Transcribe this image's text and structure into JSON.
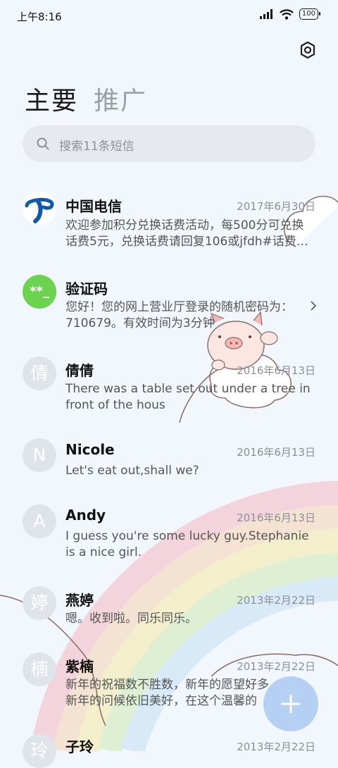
{
  "status": {
    "time": "上午8:16",
    "battery": "100"
  },
  "tabs": {
    "primary": "主要",
    "promo": "推广"
  },
  "search": {
    "placeholder": "搜索11条短信"
  },
  "avatars": {
    "verify": "**_",
    "qianqian": "倩",
    "nicole": "N",
    "andy": "A",
    "yanting": "婷",
    "zinan": "楠",
    "ziling": "玲"
  },
  "messages": [
    {
      "name": "中国电信",
      "date": "2017年6月30日",
      "line1": "欢迎参加积分兑换话费活动，每500分可兑换",
      "line2": "话费5元，兑换话费请回复106或jfdh#话费…"
    },
    {
      "name": "验证码",
      "date": "",
      "line1": "您好！您的网上营业厅登录的随机密码为：",
      "line2": "710679。有效时间为3分钟"
    },
    {
      "name": "倩倩",
      "date": "2016年6月13日",
      "line1": "There was a table set out under a tree in",
      "line2": "front of the hous"
    },
    {
      "name": "Nicole",
      "date": "2016年6月13日",
      "line1": "Let's eat out,shall we?",
      "line2": ""
    },
    {
      "name": "Andy",
      "date": "2016年6月13日",
      "line1": "I guess you're some lucky guy.Stephanie",
      "line2": "is a nice girl."
    },
    {
      "name": "燕婷",
      "date": "2013年2月22日",
      "line1": "嗯。收到啦。同乐同乐。",
      "line2": ""
    },
    {
      "name": "紫楠",
      "date": "2013年2月22日",
      "line1": "新年的祝福数不胜数，新年的愿望好多",
      "line2": "新年的问候依旧美好，在这个温馨的"
    },
    {
      "name": "子玲",
      "date": "2013年2月22日",
      "line1": "",
      "line2": ""
    }
  ],
  "colors": {
    "accent": "#b5d0f2",
    "verify_avatar": "#6cd34f",
    "telecom_blue": "#0f5aa8"
  }
}
